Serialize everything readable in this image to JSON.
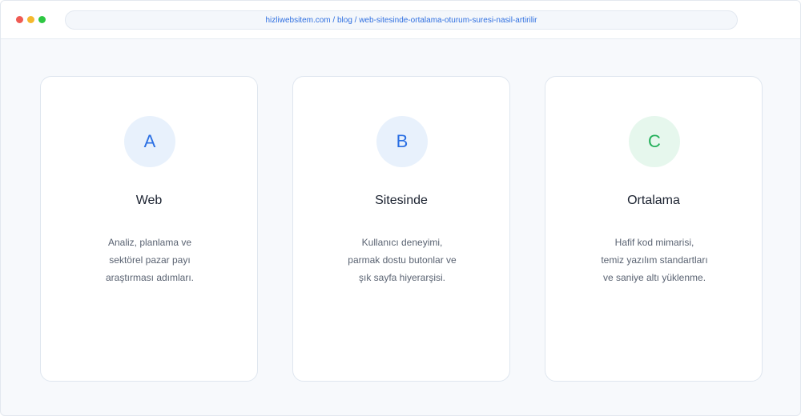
{
  "browser": {
    "url": "hizliwebsitem.com / blog / web-sitesinde-ortalama-oturum-suresi-nasil-artirilir"
  },
  "cards": [
    {
      "badge": "A",
      "badge_color": "#2a6fe3",
      "title": "Web",
      "desc_lines": [
        "Analiz, planlama ve",
        "sektörel pazar payı",
        "araştırması adımları."
      ]
    },
    {
      "badge": "B",
      "badge_color": "#2a6fe3",
      "title": "Sitesinde",
      "desc_lines": [
        "Kullanıcı deneyimi,",
        "parmak dostu butonlar ve",
        "şık sayfa hiyerarşisi."
      ]
    },
    {
      "badge": "C",
      "badge_color": "#23b05a",
      "title": "Ortalama",
      "desc_lines": [
        "Hafif kod mimarisi,",
        "temiz yazılım standartları",
        "ve saniye altı yüklenme."
      ]
    }
  ]
}
